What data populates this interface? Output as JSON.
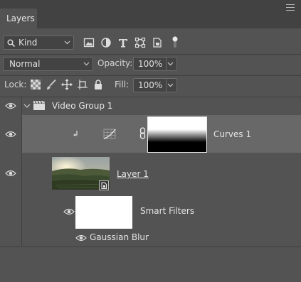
{
  "panel": {
    "tab_label": "Layers"
  },
  "filter": {
    "kind_label": "Kind"
  },
  "blend": {
    "mode": "Normal",
    "opacity_label": "Opacity:",
    "opacity_value": "100%"
  },
  "lock": {
    "label": "Lock:",
    "fill_label": "Fill:",
    "fill_value": "100%"
  },
  "layers": {
    "group": {
      "name": "Video Group 1"
    },
    "curves": {
      "name": "Curves 1"
    },
    "layer1": {
      "name": "Layer 1"
    },
    "smart_filters": {
      "name": "Smart Filters"
    },
    "gaussian": {
      "name": "Gaussian Blur"
    }
  },
  "colors": {
    "panel": "#535353",
    "tabbar": "#424242",
    "selected_row": "#686868",
    "field": "#434343"
  }
}
